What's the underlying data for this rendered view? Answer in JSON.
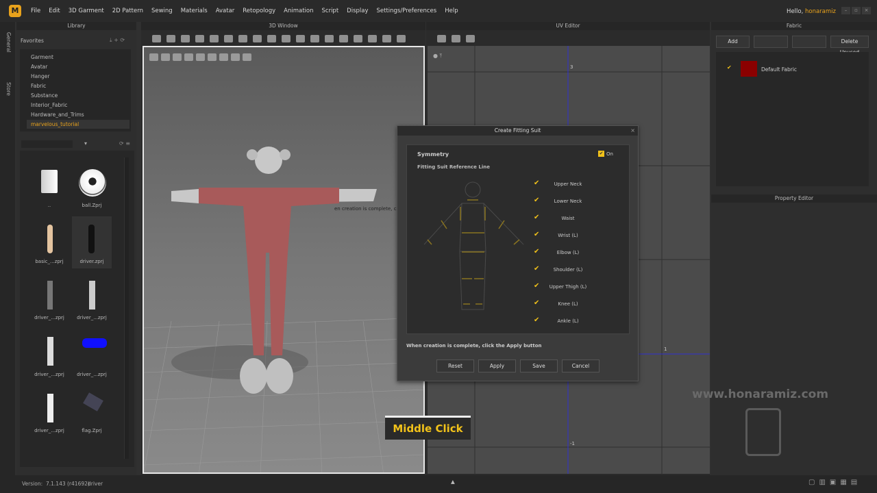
{
  "menubar": {
    "items": [
      "File",
      "Edit",
      "3D Garment",
      "2D Pattern",
      "Sewing",
      "Materials",
      "Avatar",
      "Retopology",
      "Animation",
      "Script",
      "Display",
      "Settings/Preferences",
      "Help"
    ],
    "greeting": "Hello,",
    "user": "honaramiz"
  },
  "sidetabs": [
    "General",
    "Store"
  ],
  "library": {
    "title": "Library",
    "favorites": "Favorites",
    "items": [
      "Garment",
      "Avatar",
      "Hanger",
      "Fabric",
      "Substance",
      "Interior_Fabric",
      "Hardware_and_Trims",
      "marvelous_tutorial"
    ],
    "thumbs": [
      "..",
      "ball.Zprj",
      "basic_...zprj",
      "driver.zprj",
      "driver_...zprj",
      "driver_...zprj",
      "driver_...zprj",
      "driver_...zprj",
      "driver_...zprj",
      "flag.Zprj"
    ]
  },
  "window3d": {
    "title": "3D Window",
    "tooltip": "en creation is complete, click"
  },
  "uv": {
    "title": "UV Editor",
    "labels": [
      "3",
      "1",
      "-1"
    ]
  },
  "fabric": {
    "title": "Fabric",
    "buttons": [
      "Add",
      "",
      "",
      "Delete Unused"
    ],
    "item": "Default Fabric",
    "swatch": "#8b0000"
  },
  "property": {
    "title": "Property Editor"
  },
  "dialog": {
    "title": "Create Fitting Suit",
    "symmetry": "Symmetry",
    "on": "On",
    "ref": "Fitting Suit Reference Line",
    "lines": [
      "Upper Neck",
      "Lower Neck",
      "Waist",
      "Wrist (L)",
      "Elbow (L)",
      "Shoulder (L)",
      "Upper Thigh (L)",
      "Knee (L)",
      "Ankle (L)"
    ],
    "hint": "When creation is complete, click the Apply button",
    "buttons": [
      "Reset",
      "Apply",
      "Save",
      "Cancel"
    ]
  },
  "status": {
    "version_label": "Version:",
    "version": "7.1.143 (r41692)",
    "file": "driver"
  },
  "overlay": {
    "middle_click": "Middle Click",
    "watermark": "www.honaramiz.com"
  },
  "colors": {
    "accent": "#e8a21c",
    "check": "#f2c21a"
  }
}
